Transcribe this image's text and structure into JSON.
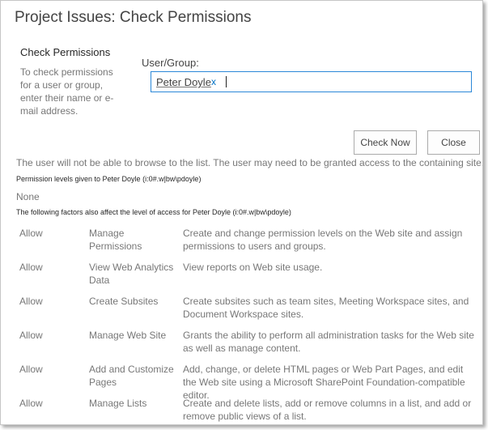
{
  "dialog": {
    "title": "Project Issues: Check Permissions"
  },
  "left_panel": {
    "heading": "Check Permissions",
    "description": "To check permissions for a user or group, enter their name or e-mail address."
  },
  "user_group": {
    "label": "User/Group:",
    "resolved_entity": "Peter Doyle",
    "remove_glyph": "x",
    "focus_color": "#2b88d8"
  },
  "buttons": {
    "check_now": "Check Now",
    "close": "Close"
  },
  "results": {
    "warning": "The user will not be able to browse to the list. The user may need to be granted access to the containing site.",
    "permission_levels_heading": "Permission levels given to Peter Doyle (i:0#.w|bw\\pdoyle)",
    "permission_levels_value": "None",
    "factors_heading": "The following factors also affect the level of access for Peter Doyle (i:0#.w|bw\\pdoyle)"
  },
  "permissions": [
    {
      "effect": "Allow",
      "name": "Manage Permissions",
      "description": "Create and change permission levels on the Web site and assign permissions to users and groups."
    },
    {
      "effect": "Allow",
      "name": "View Web Analytics Data",
      "description": "View reports on Web site usage."
    },
    {
      "effect": "Allow",
      "name": "Create Subsites",
      "description": "Create subsites such as team sites, Meeting Workspace sites, and Document Workspace sites."
    },
    {
      "effect": "Allow",
      "name": "Manage Web Site",
      "description": "Grants the ability to perform all administration tasks for the Web site as well as manage content."
    },
    {
      "effect": "Allow",
      "name": "Add and Customize Pages",
      "description": "Add, change, or delete HTML pages or Web Part Pages, and edit the Web site using a Microsoft SharePoint Foundation-compatible editor."
    },
    {
      "effect": "Allow",
      "name": "Manage Lists",
      "description": "Create and delete lists, add or remove columns in a list, and add or remove public views of a list."
    }
  ]
}
